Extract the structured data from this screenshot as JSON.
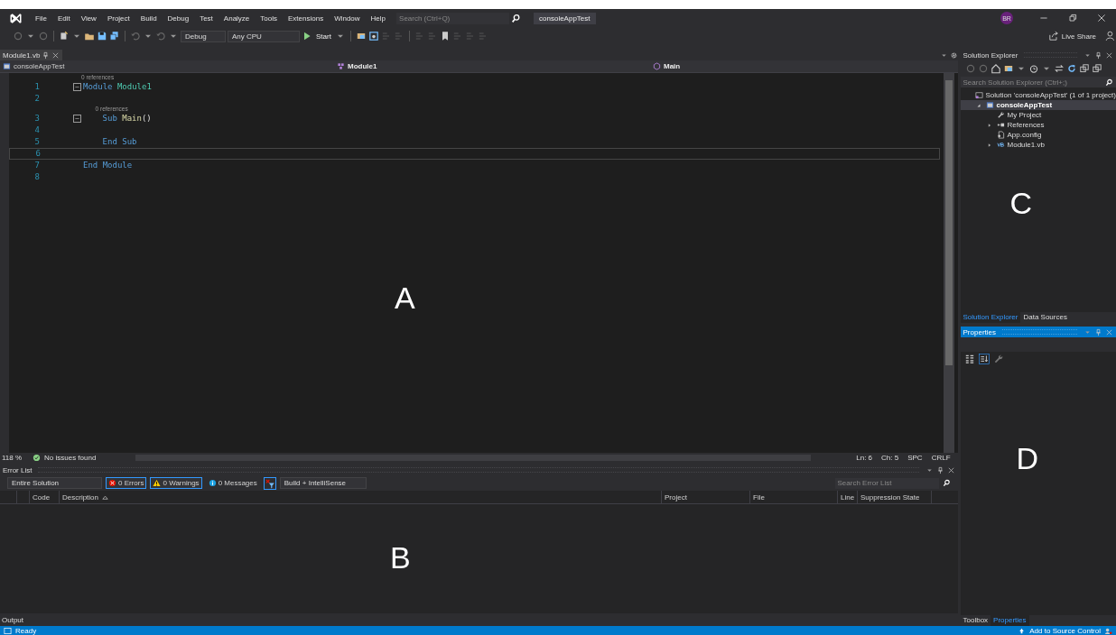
{
  "menu_bar": {
    "items": [
      "File",
      "Edit",
      "View",
      "Project",
      "Build",
      "Debug",
      "Test",
      "Analyze",
      "Tools",
      "Extensions",
      "Window",
      "Help"
    ],
    "search": {
      "placeholder": "Search (Ctrl+Q)"
    },
    "solution_name": "consoleAppTest",
    "avatar": "BR"
  },
  "toolbar": {
    "configuration": "Debug",
    "platform": "Any CPU",
    "start": "Start",
    "live_share": "Live Share"
  },
  "document_tabs": [
    {
      "label": "Module1.vb",
      "selected": true
    }
  ],
  "nav_bar": {
    "project": "consoleAppTest",
    "type": "Module1",
    "member": "Main"
  },
  "editor": {
    "annotation": "A",
    "lines": [
      {
        "number": "1",
        "lens": "0 references",
        "fold": true,
        "current": false,
        "tokens": [
          {
            "kind": "keyword",
            "text": "Module"
          },
          {
            "kind": "type",
            "text": "Module1"
          }
        ],
        "children": [
          {
            "number": "2",
            "fold": false,
            "current": false
          },
          {
            "number": "3",
            "lens": "0 references",
            "fold": true,
            "current": false,
            "tokens": [
              {
                "kind": "keyword",
                "text": "Sub"
              },
              {
                "kind": "method",
                "text": "Main"
              },
              {
                "kind": "punct",
                "text": "()"
              }
            ],
            "children": [
              {
                "number": "4",
                "fold": false,
                "current": false
              }
            ]
          },
          {
            "number": "5",
            "fold": false,
            "current": false,
            "tokens": [
              {
                "kind": "keyword",
                "text": "End Sub"
              }
            ]
          },
          {
            "number": "6",
            "fold": false,
            "current": true
          }
        ]
      },
      {
        "number": "7",
        "fold": false,
        "current": false,
        "tokens": [
          {
            "kind": "keyword",
            "text": "End Module"
          }
        ]
      },
      {
        "number": "8",
        "fold": false,
        "current": false
      }
    ],
    "footer": {
      "zoom": "118 %",
      "issues": "No issues found",
      "line": "Ln: 6",
      "column": "Ch: 5",
      "whitespace": "SPC",
      "line_endings": "CRLF"
    }
  },
  "error_list": {
    "title": "Error List",
    "annotation": "B",
    "scope": "Entire Solution",
    "filters": [
      {
        "kind": "error",
        "label": "0 Errors",
        "selected": true
      },
      {
        "kind": "warning",
        "label": "0 Warnings",
        "selected": true
      },
      {
        "kind": "message",
        "label": "0 Messages",
        "selected": false
      }
    ],
    "build_filter": "Build + IntelliSense",
    "search": {
      "placeholder": "Search Error List"
    },
    "columns": [
      "Code",
      "Description",
      "Project",
      "File",
      "Line",
      "Suppression State"
    ]
  },
  "bottom_tabs": [
    {
      "label": "Output",
      "selected": false
    }
  ],
  "solution_explorer": {
    "title": "Solution Explorer",
    "annotation": "C",
    "search": {
      "placeholder": "Search Solution Explorer (Ctrl+;)"
    },
    "tree": [
      {
        "kind": "solution",
        "label": "Solution 'consoleAppTest' (1 of 1 project)",
        "selected": false,
        "children": [
          {
            "kind": "project",
            "label": "consoleAppTest",
            "selected": true,
            "expanded": true,
            "children": [
              {
                "kind": "settings",
                "label": "My Project",
                "selected": false
              },
              {
                "kind": "references",
                "label": "References",
                "selected": false,
                "expanded": false
              },
              {
                "kind": "config",
                "label": "App.config",
                "selected": false
              },
              {
                "kind": "vbfile",
                "label": "Module1.vb",
                "selected": false,
                "expanded": false
              }
            ]
          }
        ]
      }
    ],
    "tabs": [
      {
        "label": "Solution Explorer",
        "selected": true
      },
      {
        "label": "Data Sources",
        "selected": false
      }
    ]
  },
  "properties": {
    "title": "Properties",
    "annotation": "D",
    "tabs": [
      {
        "label": "Toolbox",
        "selected": false
      },
      {
        "label": "Properties",
        "selected": true
      }
    ]
  },
  "status_bar": {
    "message": "Ready",
    "source_control": "Add to Source Control"
  }
}
